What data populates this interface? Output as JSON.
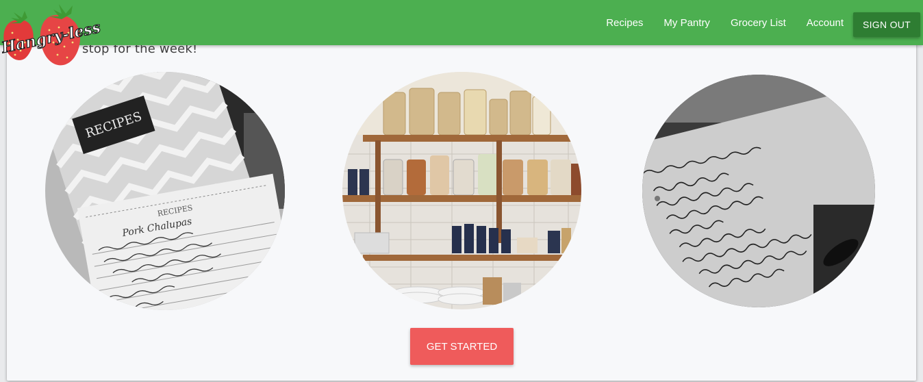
{
  "brand": {
    "name": "Hangry-less"
  },
  "nav": {
    "links": [
      "Recipes",
      "My Pantry",
      "Grocery List",
      "Account"
    ],
    "sign_out": "SIGN OUT"
  },
  "hero": {
    "tagline_visible": "stop for the week!",
    "cta": "GET STARTED"
  },
  "photos": [
    {
      "subject": "recipe-cards",
      "card_text": "RECIPES",
      "recipe_title": "Pork Chalupas"
    },
    {
      "subject": "pantry-shelves"
    },
    {
      "subject": "handwritten-menu"
    }
  ],
  "colors": {
    "navbar": "#4caf50",
    "sign_out": "#2e7d32",
    "cta": "#ef5b5b",
    "page_bg": "#f7f8fa"
  }
}
